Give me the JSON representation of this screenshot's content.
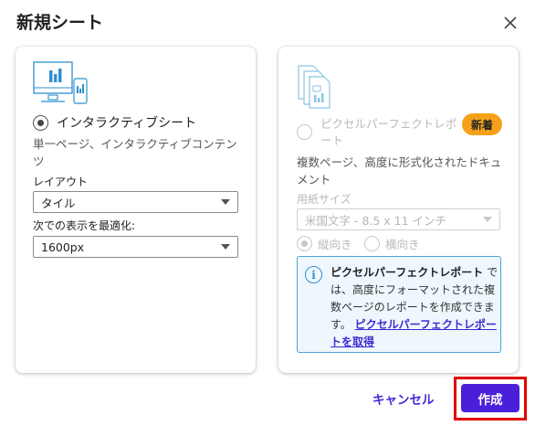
{
  "dialog": {
    "title": "新規シート"
  },
  "interactive_card": {
    "option_label": "インタラクティブシート",
    "description": "単一ページ、インタラクティブコンテンツ",
    "layout_label": "レイアウト",
    "layout_value": "タイル",
    "optimize_label": "次での表示を最適化:",
    "optimize_value": "1600px",
    "selected": true
  },
  "paginated_card": {
    "option_label": "ピクセルパーフェクトレポート",
    "badge": "新着",
    "description": "複数ページ、高度に形式化されたドキュメント",
    "paper_size_label": "用紙サイズ",
    "paper_size_value": "米国文字 - 8.5 x 11 インチ",
    "orientation_portrait": "縦向き",
    "orientation_landscape": "横向き",
    "info": {
      "bold": "ピクセルパーフェクトレポート",
      "text": "では、高度にフォーマットされた複数ページのレポートを作成できます。",
      "link": "ピクセルパーフェクトレポートを取得"
    }
  },
  "footer": {
    "cancel_label": "キャンセル",
    "create_label": "作成"
  },
  "colors": {
    "primary": "#4a1fd9",
    "badge": "#f5a21a",
    "highlight": "#e00000",
    "info_border": "#49a4d6"
  }
}
